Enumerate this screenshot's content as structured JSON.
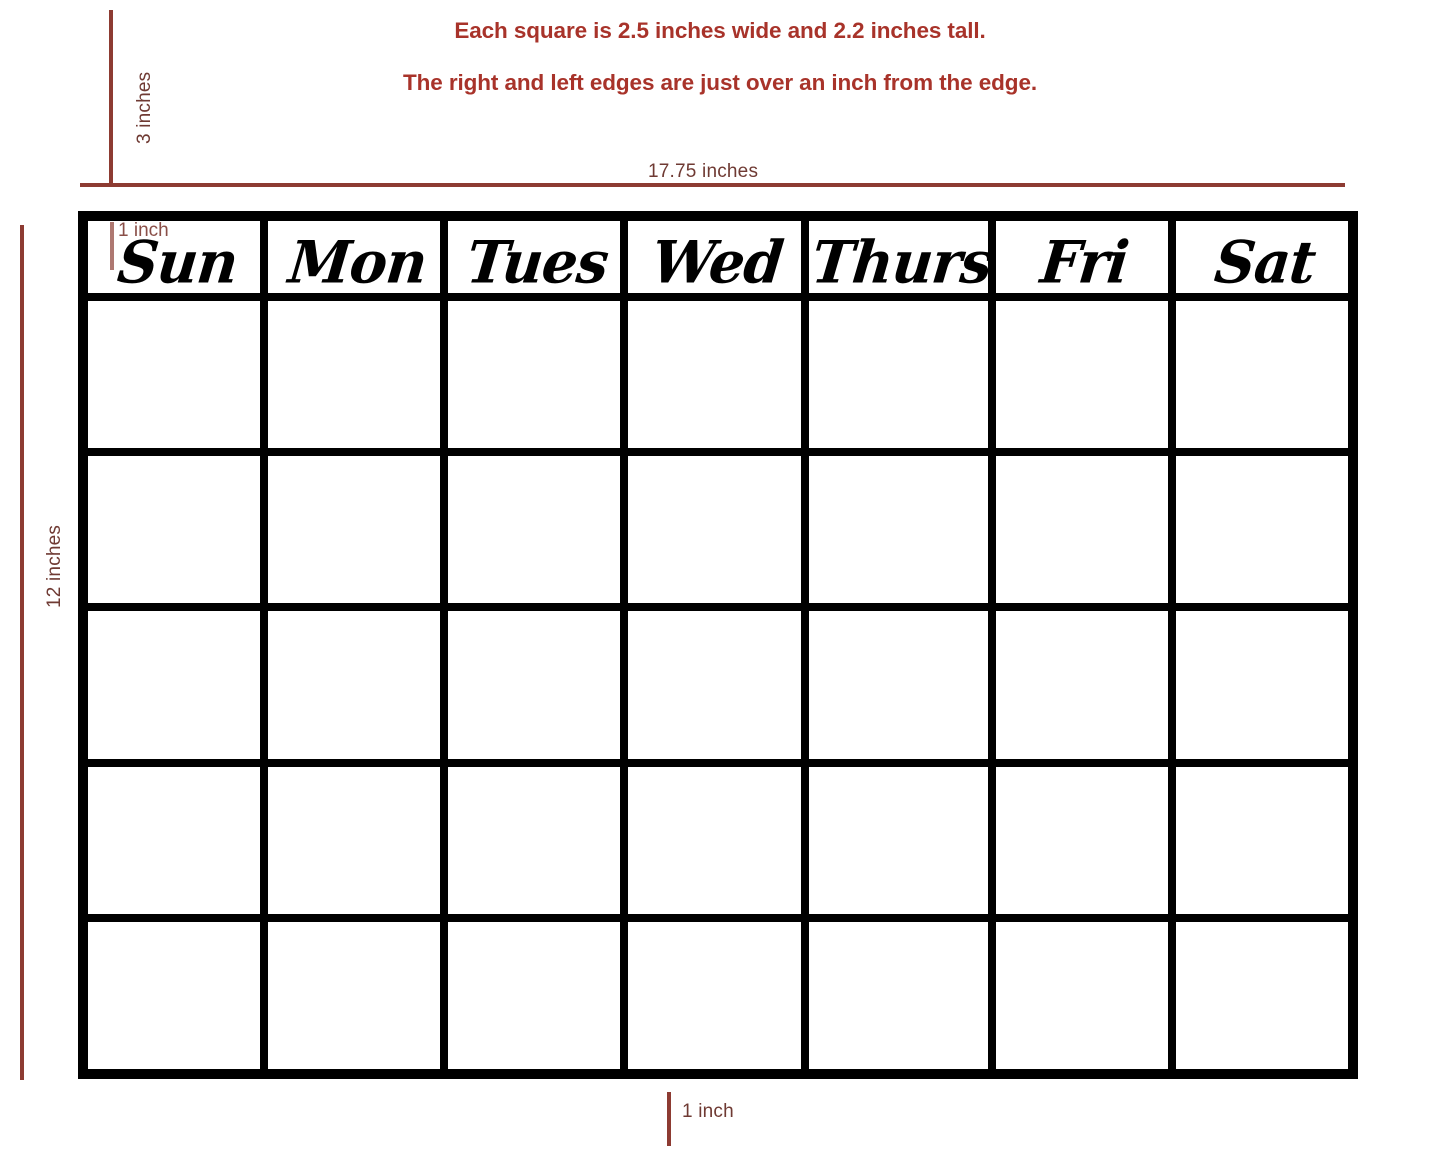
{
  "headings": {
    "line1": "Each square is 2.5 inches wide and 2.2 inches tall.",
    "line2": "The right and left edges are just over an inch from the edge.",
    "color": "#a8332a"
  },
  "measurements": {
    "top_vertical": "3 inches",
    "top_horizontal": "17.75 inches",
    "left_vertical": "12 inches",
    "grid_left_inset": "1 inch",
    "bottom_inset": "1 inch",
    "rule_color": "#8d3b32",
    "label_color": "#6f3a33"
  },
  "calendar": {
    "day_headers": [
      "Sun",
      "Mon",
      "Tues",
      "Wed",
      "Thurs",
      "Fri",
      "Sat"
    ],
    "week_rows": 5,
    "columns": 7,
    "border_color": "#000000",
    "cell_background": "#ffffff",
    "cells": [
      [
        "",
        "",
        "",
        "",
        "",
        "",
        ""
      ],
      [
        "",
        "",
        "",
        "",
        "",
        "",
        ""
      ],
      [
        "",
        "",
        "",
        "",
        "",
        "",
        ""
      ],
      [
        "",
        "",
        "",
        "",
        "",
        "",
        ""
      ],
      [
        "",
        "",
        "",
        "",
        "",
        "",
        ""
      ]
    ]
  }
}
